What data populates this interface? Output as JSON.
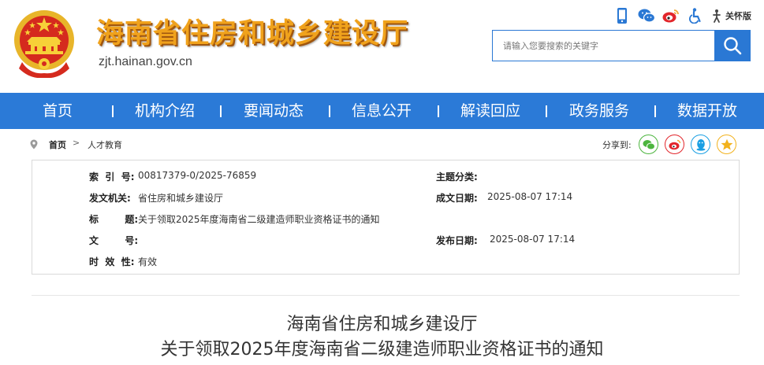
{
  "site": {
    "title": "海南省住房和城乡建设厅",
    "domain": "zjt.hainan.gov.cn"
  },
  "tools": {
    "icons": [
      "mobile-icon",
      "wechat-icon",
      "weibo-icon",
      "accessibility-icon",
      "care-mode-icon"
    ],
    "care_mode_label": "关怀版"
  },
  "search": {
    "placeholder": "请输入您要搜索的关键字"
  },
  "nav": {
    "items": [
      "首页",
      "机构介绍",
      "要闻动态",
      "信息公开",
      "解读回应",
      "政务服务",
      "数据开放"
    ],
    "color": "#2b7ad7"
  },
  "breadcrumb": {
    "home": "首页",
    "arrow": ">",
    "current": "人才教育"
  },
  "share": {
    "label": "分享到:",
    "targets": [
      "wechat-share-icon",
      "weibo-share-icon",
      "qq-share-icon",
      "qzone-share-icon"
    ]
  },
  "meta": {
    "index_label": "索  引  号:",
    "index_value": "00817379-0/2025-76859",
    "topic_label": "主题分类:",
    "topic_value": "",
    "issuer_label": "发文机关:",
    "issuer_value": "省住房和城乡建设厅",
    "date_label": "成文日期:",
    "date_value": "2025-08-07 17:14",
    "subject_label": "标        题:",
    "subject_value": "关于领取2025年度海南省二级建造师职业资格证书的通知",
    "docno_label": "文        号:",
    "docno_value": "",
    "publish_label": "发布日期:",
    "publish_value": "2025-08-07 17:14",
    "validity_label": "时  效  性:",
    "validity_value": "有效"
  },
  "article": {
    "org": "海南省住房和城乡建设厅",
    "title": "关于领取2025年度海南省二级建造师职业资格证书的通知"
  }
}
